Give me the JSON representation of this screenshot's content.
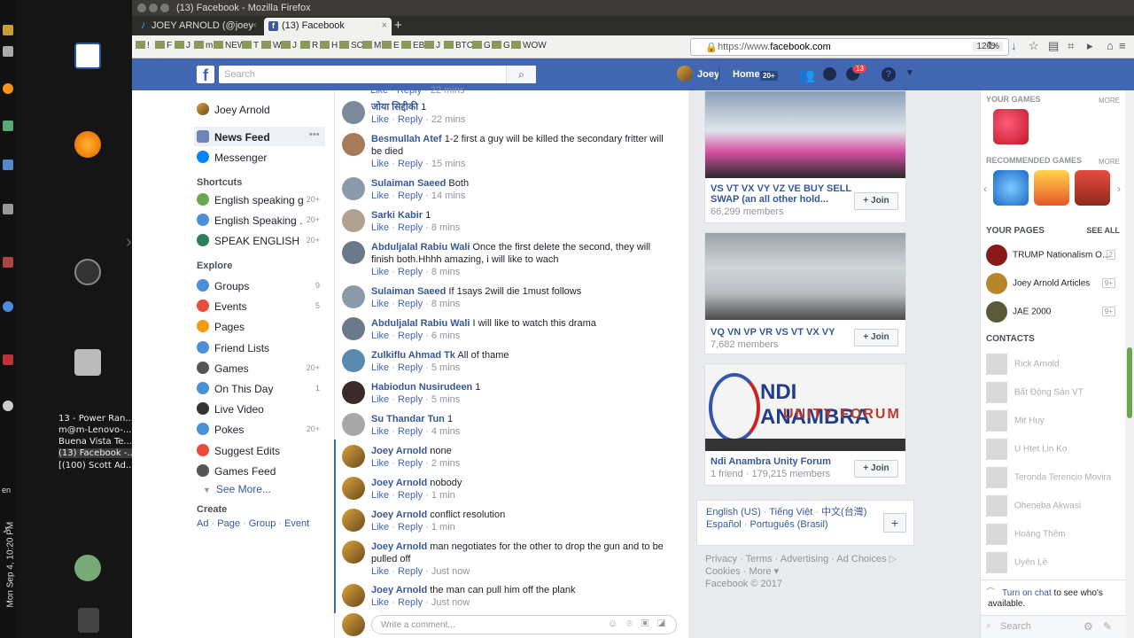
{
  "os": {
    "clock": "Mon Sep 4, 10:20 PM",
    "lang": "en",
    "windows": [
      "13 - Power Ran...",
      "m@m-Lenovo-...",
      "Buena Vista Te...",
      "(13) Facebook -...",
      "[(100) Scott Ad..."
    ]
  },
  "browser": {
    "title": "(13) Facebook - Mozilla Firefox",
    "tabs": [
      {
        "label": "JOEY ARNOLD (@joey"
      },
      {
        "label": "(13) Facebook"
      }
    ],
    "url_prefix": "https://www.",
    "url_host": "facebook.com",
    "zoom": "120%",
    "bookmarks": [
      "!",
      "F",
      "J",
      "m",
      "NEW",
      "T",
      "W",
      "J",
      "R",
      "H",
      "SC",
      "M",
      "E",
      "EB",
      "J",
      "BTC",
      "G",
      "G",
      "WOW"
    ]
  },
  "header": {
    "logo": "f",
    "search_placeholder": "Search",
    "user": "Joey",
    "home": "Home",
    "home_count": "20+",
    "notif_count": "13"
  },
  "left": {
    "profile": "Joey Arnold",
    "news_feed": "News Feed",
    "messenger": "Messenger",
    "shortcuts_head": "Shortcuts",
    "shortcuts": [
      {
        "label": "English speaking g...",
        "count": "20+"
      },
      {
        "label": "English Speaking ...",
        "count": "20+"
      },
      {
        "label": "SPEAK ENGLISH F...",
        "count": "20+"
      }
    ],
    "explore_head": "Explore",
    "explore": [
      {
        "label": "Groups",
        "count": "9"
      },
      {
        "label": "Events",
        "count": "5"
      },
      {
        "label": "Pages",
        "count": ""
      },
      {
        "label": "Friend Lists",
        "count": ""
      },
      {
        "label": "Games",
        "count": "20+"
      },
      {
        "label": "On This Day",
        "count": "1"
      },
      {
        "label": "Live Video",
        "count": ""
      },
      {
        "label": "Pokes",
        "count": "20+"
      },
      {
        "label": "Suggest Edits",
        "count": ""
      },
      {
        "label": "Games Feed",
        "count": ""
      }
    ],
    "see_more": "See More...",
    "create_head": "Create",
    "create_links": [
      "Ad",
      "Page",
      "Group",
      "Event"
    ]
  },
  "comments": [
    {
      "name": "जोया सिद्दीकी",
      "text": "1",
      "time": "22 mins"
    },
    {
      "name": "Besmullah Atef",
      "text": "1-2 first a guy will be killed the secondary fritter will be died",
      "time": "15 mins"
    },
    {
      "name": "Sulaiman Saeed",
      "text": "Both",
      "time": "14 mins"
    },
    {
      "name": "Sarki Kabir",
      "text": "1",
      "time": "8 mins"
    },
    {
      "name": "Abduljalal Rabiu Wali",
      "text": "Once the first delete the second, they will finish both.Hhhh amazing, i will like to wach",
      "time": "8 mins"
    },
    {
      "name": "Sulaiman Saeed",
      "text": "If 1says 2will die 1must follows",
      "time": "8 mins"
    },
    {
      "name": "Abduljalal Rabiu Wali",
      "text": "I will like to watch this drama",
      "time": "6 mins"
    },
    {
      "name": "Zulkiflu Ahmad Tk",
      "text": "All of thame",
      "time": "5 mins"
    },
    {
      "name": "Habiodun Nusirudeen",
      "text": "1",
      "time": "5 mins"
    },
    {
      "name": "Su Thandar Tun",
      "text": "1",
      "time": "4 mins"
    },
    {
      "name": "Joey Arnold",
      "text": "none",
      "time": "2 mins"
    },
    {
      "name": "Joey Arnold",
      "text": "nobody",
      "time": "1 min"
    },
    {
      "name": "Joey Arnold",
      "text": "conflict resolution",
      "time": "1 min"
    },
    {
      "name": "Joey Arnold",
      "text": "man negotiates for the other to drop the gun and to be pulled off",
      "time": "Just now"
    },
    {
      "name": "Joey Arnold",
      "text": "the man can pull him off the plank",
      "time": "Just now"
    }
  ],
  "comment_actions": {
    "like": "Like",
    "reply": "Reply",
    "sep": "·",
    "partial_time": "22 mins"
  },
  "comment_input_placeholder": "Write a comment...",
  "groups": [
    {
      "name": "VS VT VX VY VZ VE BUY SELL SWAP (an all other hold...",
      "members": "66,299 members",
      "join": "Join"
    },
    {
      "name": "VQ VN VP VR VS VT VX VY",
      "members": "7,682 members",
      "join": "Join"
    },
    {
      "name": "Ndi Anambra Unity Forum",
      "members": "1 friend · 179,215 members",
      "join": "Join"
    }
  ],
  "ndi_banner": {
    "line1": "NDI ANAMBRA",
    "line2": "UNITY FORUM"
  },
  "languages": {
    "line1": [
      "English (US)",
      "Tiếng Việt",
      "中文(台灣)"
    ],
    "line2": [
      "Español",
      "Português (Brasil)"
    ],
    "add": "+"
  },
  "footer": {
    "links": [
      "Privacy",
      "Terms",
      "Advertising",
      "Ad Choices",
      "Cookies",
      "More"
    ],
    "copyright": "Facebook © 2017"
  },
  "rail": {
    "your_games": "YOUR GAMES",
    "more": "MORE",
    "recommended": "RECOMMENDED GAMES",
    "your_pages": "YOUR PAGES",
    "see_all": "SEE ALL",
    "pages": [
      {
        "name": "TRUMP Nationalism O...",
        "badge": "2"
      },
      {
        "name": "Joey Arnold Articles",
        "badge": "9+"
      },
      {
        "name": "JAE 2000",
        "badge": "9+"
      }
    ],
    "contacts_head": "CONTACTS",
    "contacts": [
      "Rick Arnold",
      "Bất Động Sản VT",
      "Mit Huy",
      "U Htet Lin Ko",
      "Teronda Terencio Movira",
      "Oheneba Akwasi",
      "Hoàng Thêm",
      "Uyên Lê"
    ],
    "chat_link": "Turn on chat",
    "chat_rest": " to see who's available.",
    "search": "Search"
  }
}
